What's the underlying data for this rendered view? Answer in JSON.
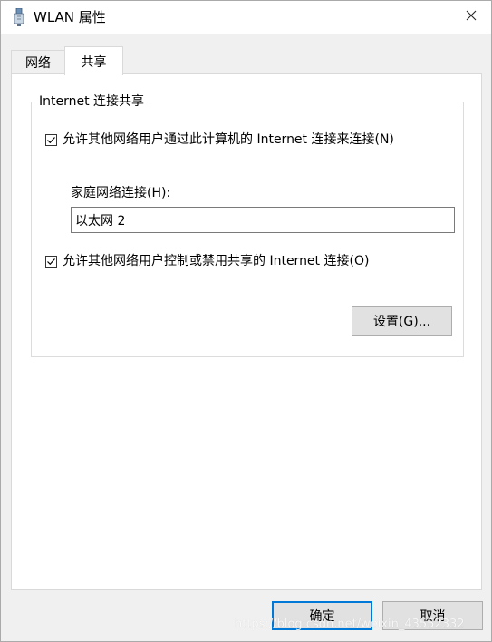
{
  "window": {
    "title": "WLAN 属性"
  },
  "tabs": [
    {
      "label": "网络",
      "active": false
    },
    {
      "label": "共享",
      "active": true
    }
  ],
  "group": {
    "legend": "Internet 连接共享",
    "allow_connect": {
      "label": "允许其他网络用户通过此计算机的 Internet 连接来连接(N)",
      "checked": true
    },
    "home_connection": {
      "label": "家庭网络连接(H):",
      "value": "以太网 2"
    },
    "allow_control": {
      "label": "允许其他网络用户控制或禁用共享的 Internet 连接(O)",
      "checked": true
    },
    "settings_label": "设置(G)..."
  },
  "buttons": {
    "ok": "确定",
    "cancel": "取消"
  },
  "watermark": "https://blog.csdn.net/weixin_43552332",
  "colors": {
    "accent": "#0078d7",
    "button_bg": "#e1e1e1",
    "panel_bg": "#ffffff",
    "window_bg": "#f0f0f0"
  }
}
